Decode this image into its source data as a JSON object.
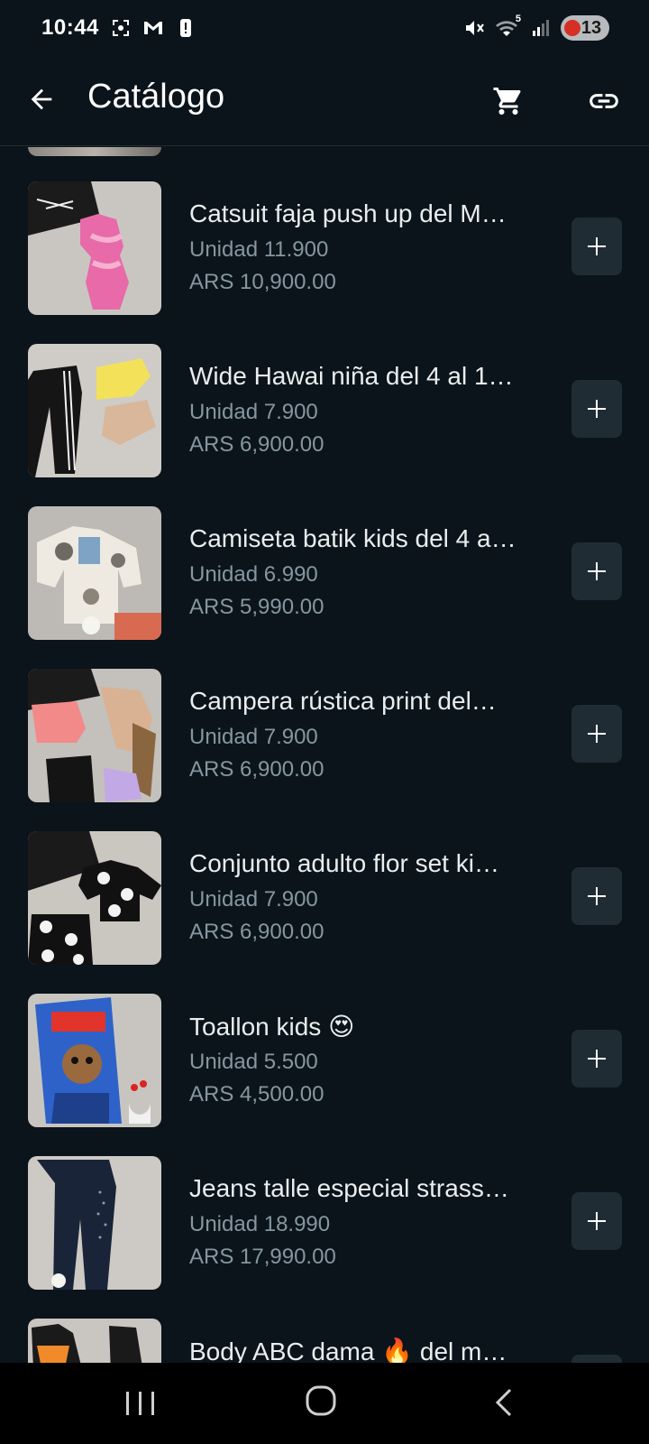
{
  "status_bar": {
    "time": "10:44",
    "left_icons": [
      "screenshot-icon",
      "gmail-icon",
      "alert-icon"
    ],
    "right_icons": [
      "mute-icon",
      "wifi-icon",
      "signal-icon"
    ],
    "wifi_badge": "5",
    "battery_level": "13"
  },
  "header": {
    "title": "Catálogo",
    "back_icon": "arrow-left-icon",
    "cart_icon": "cart-icon",
    "link_icon": "link-icon"
  },
  "products": [
    {
      "name": "Catsuit faja push up del M…",
      "unit": "Unidad 11.900",
      "price": "ARS 10,900.00",
      "thumb": "pink-catsuit"
    },
    {
      "name": "Wide Hawai niña del 4 al 1…",
      "unit": "Unidad 7.900",
      "price": "ARS 6,900.00",
      "thumb": "pants"
    },
    {
      "name": "Camiseta batik kids del 4 a…",
      "unit": "Unidad 6.990",
      "price": "ARS 5,990.00",
      "thumb": "batik-shirt"
    },
    {
      "name": "Campera rústica print del…",
      "unit": "Unidad 7.900",
      "price": "ARS 6,900.00",
      "thumb": "jackets"
    },
    {
      "name": "Conjunto adulto flor set ki…",
      "unit": "Unidad 7.900",
      "price": "ARS 6,900.00",
      "thumb": "flower-set"
    },
    {
      "name": "Toallon kids 😍",
      "unit": "Unidad 5.500",
      "price": "ARS 4,500.00",
      "thumb": "towel"
    },
    {
      "name": "Jeans talle especial strass…",
      "unit": "Unidad 18.990",
      "price": "ARS 17,990.00",
      "thumb": "jeans"
    },
    {
      "name": "Body ABC dama 🔥 del m…",
      "unit": "",
      "price": "",
      "thumb": "body"
    }
  ],
  "colors": {
    "background": "#0b141a",
    "text_primary": "#e9edef",
    "text_secondary": "#8696a0",
    "button_bg": "#1f2c33"
  },
  "nav_bar": {
    "icons": [
      "recent-apps-icon",
      "home-icon",
      "back-icon"
    ]
  }
}
